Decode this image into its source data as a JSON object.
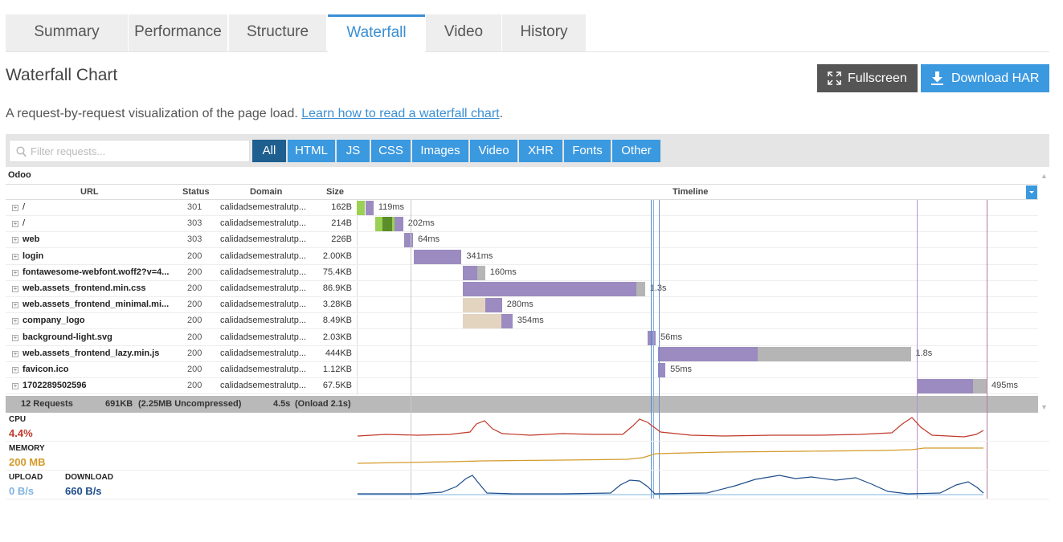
{
  "tabs": [
    "Summary",
    "Performance",
    "Structure",
    "Waterfall",
    "Video",
    "History"
  ],
  "active_tab": "Waterfall",
  "page_title": "Waterfall Chart",
  "buttons": {
    "fullscreen": "Fullscreen",
    "download_har": "Download HAR"
  },
  "description": {
    "text": "A request-by-request visualization of the page load.",
    "link": "Learn how to read a waterfall chart",
    "suffix": "."
  },
  "filter": {
    "placeholder": "Filter requests...",
    "types": [
      "All",
      "HTML",
      "JS",
      "CSS",
      "Images",
      "Video",
      "XHR",
      "Fonts",
      "Other"
    ],
    "active": "All"
  },
  "group_name": "Odoo",
  "columns": {
    "url": "URL",
    "status": "Status",
    "domain": "Domain",
    "size": "Size",
    "timeline": "Timeline"
  },
  "requests": [
    {
      "url": "/",
      "status": "301",
      "domain": "calidadsemestralutp...",
      "size": "162B",
      "duration": "119ms",
      "phases": [
        {
          "t": "lime",
          "s": 0,
          "e": 0.003
        },
        {
          "t": "dns",
          "s": 0.003,
          "e": 0.06
        },
        {
          "t": "ttfb",
          "s": 0.06,
          "e": 0.119
        }
      ]
    },
    {
      "url": "/",
      "status": "303",
      "domain": "calidadsemestralutp...",
      "size": "214B",
      "duration": "202ms",
      "phases": [
        {
          "t": "lime",
          "s": 0.13,
          "e": 0.185
        },
        {
          "t": "ssl",
          "s": 0.185,
          "e": 0.25
        },
        {
          "t": "lime",
          "s": 0.25,
          "e": 0.27
        },
        {
          "t": "ttfb",
          "s": 0.27,
          "e": 0.33
        }
      ]
    },
    {
      "url": "web",
      "status": "303",
      "domain": "calidadsemestralutp...",
      "size": "226B",
      "duration": "64ms",
      "phases": [
        {
          "t": "ttfb",
          "s": 0.337,
          "e": 0.401
        }
      ]
    },
    {
      "url": "login",
      "status": "200",
      "domain": "calidadsemestralutp...",
      "size": "2.00KB",
      "duration": "341ms",
      "phases": [
        {
          "t": "ttfb",
          "s": 0.404,
          "e": 0.745
        }
      ]
    },
    {
      "url": "fontawesome-webfont.woff2?v=4...",
      "status": "200",
      "domain": "calidadsemestralutp...",
      "size": "75.4KB",
      "duration": "160ms",
      "phases": [
        {
          "t": "ttfb",
          "s": 0.753,
          "e": 0.858
        },
        {
          "t": "dl",
          "s": 0.858,
          "e": 0.913
        }
      ]
    },
    {
      "url": "web.assets_frontend.min.css",
      "status": "200",
      "domain": "calidadsemestralutp...",
      "size": "86.9KB",
      "duration": "1.3s",
      "phases": [
        {
          "t": "ttfb",
          "s": 0.753,
          "e": 1.99
        },
        {
          "t": "dl",
          "s": 1.99,
          "e": 2.05
        }
      ]
    },
    {
      "url": "web.assets_frontend_minimal.mi...",
      "status": "200",
      "domain": "calidadsemestralutp...",
      "size": "3.28KB",
      "duration": "280ms",
      "phases": [
        {
          "t": "blocked",
          "s": 0.753,
          "e": 0.913
        },
        {
          "t": "ttfb",
          "s": 0.913,
          "e": 1.033
        }
      ]
    },
    {
      "url": "company_logo",
      "status": "200",
      "domain": "calidadsemestralutp...",
      "size": "8.49KB",
      "duration": "354ms",
      "phases": [
        {
          "t": "blocked",
          "s": 0.753,
          "e": 1.03
        },
        {
          "t": "ttfb",
          "s": 1.03,
          "e": 1.107
        }
      ]
    },
    {
      "url": "background-light.svg",
      "status": "200",
      "domain": "calidadsemestralutp...",
      "size": "2.03KB",
      "duration": "56ms",
      "phases": [
        {
          "t": "ttfb",
          "s": 2.07,
          "e": 2.126
        }
      ]
    },
    {
      "url": "web.assets_frontend_lazy.min.js",
      "status": "200",
      "domain": "calidadsemestralutp...",
      "size": "444KB",
      "duration": "1.8s",
      "phases": [
        {
          "t": "ttfb",
          "s": 2.14,
          "e": 2.85
        },
        {
          "t": "dl",
          "s": 2.85,
          "e": 3.94
        }
      ]
    },
    {
      "url": "favicon.ico",
      "status": "200",
      "domain": "calidadsemestralutp...",
      "size": "1.12KB",
      "duration": "55ms",
      "phases": [
        {
          "t": "ttfb",
          "s": 2.14,
          "e": 2.195
        }
      ]
    },
    {
      "url": "1702289502596",
      "status": "200",
      "domain": "calidadsemestralutp...",
      "size": "67.5KB",
      "duration": "495ms",
      "phases": [
        {
          "t": "ttfb",
          "s": 3.985,
          "e": 4.38
        },
        {
          "t": "dl",
          "s": 4.38,
          "e": 4.48
        }
      ]
    }
  ],
  "phase_colors": {
    "lime": "#9ad053",
    "dns": "#9ad053",
    "ssl": "#5b8d2a",
    "ttfb": "#9b8bc0",
    "dl": "#b5b5b5",
    "blocked": "#e3d4c0"
  },
  "timeline_total_s": 4.5,
  "markers": [
    {
      "t": 0.38,
      "color": "#c9c9c9"
    },
    {
      "t": 2.09,
      "color": "#5c87c8"
    },
    {
      "t": 2.11,
      "color": "#7fb0e6"
    },
    {
      "t": 2.15,
      "color": "#6a8fd0"
    },
    {
      "t": 3.985,
      "color": "#b88fc9"
    },
    {
      "t": 4.48,
      "color": "#b37a9b"
    }
  ],
  "summary": {
    "requests": "12 Requests",
    "size": "691KB",
    "uncompressed": "(2.25MB Uncompressed)",
    "time": "4.5s",
    "onload": "(Onload 2.1s)"
  },
  "metrics": {
    "cpu": {
      "label": "CPU",
      "value": "4.4%",
      "color": "#c0392b"
    },
    "memory": {
      "label": "MEMORY",
      "value": "200 MB",
      "color": "#d49a2a"
    },
    "upload": {
      "label": "UPLOAD",
      "value": "0 B/s",
      "color": "#7fb3e0"
    },
    "download": {
      "label": "DOWNLOAD",
      "value": "660 B/s",
      "color": "#1f4e8c"
    }
  },
  "accent_color": "#3b99e0"
}
